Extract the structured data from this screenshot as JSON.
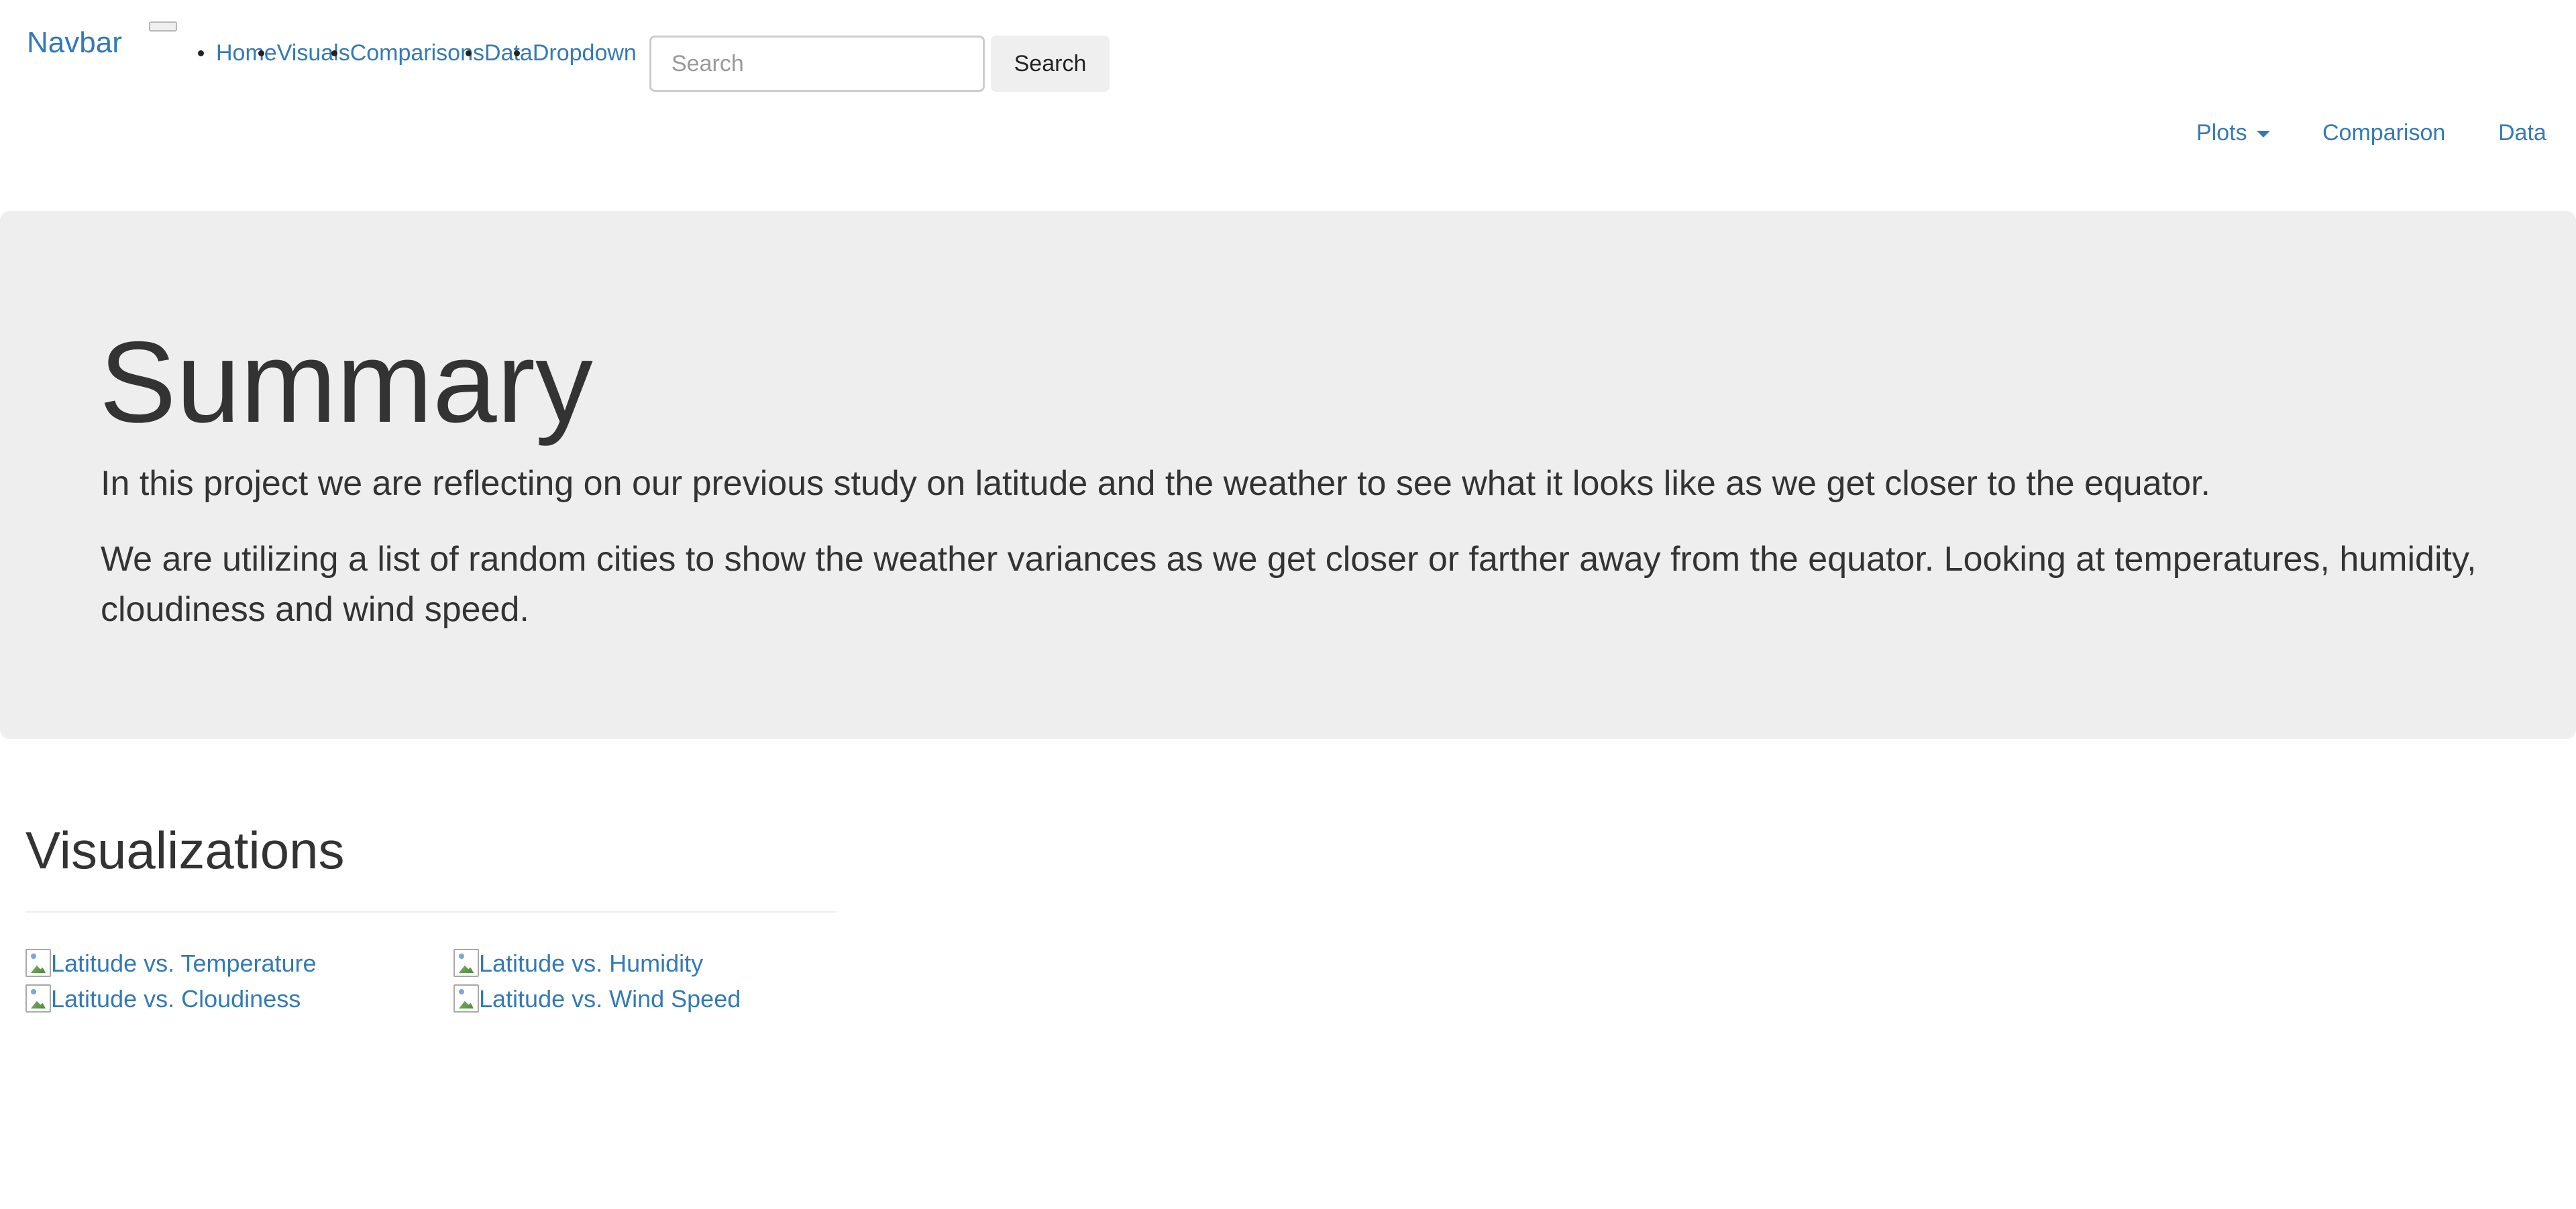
{
  "navbar": {
    "brand": "Navbar",
    "links": [
      {
        "label": "Home"
      },
      {
        "label": "Visuals"
      },
      {
        "label": "Comparisons"
      },
      {
        "label": "Data"
      },
      {
        "label": "Dropdown"
      }
    ],
    "search": {
      "placeholder": "Search",
      "value": "",
      "button_label": "Search"
    },
    "right_links": {
      "plots": "Plots",
      "comparison": "Comparison",
      "data": "Data"
    }
  },
  "jumbotron": {
    "title": "Summary",
    "paragraphs": [
      "In this project we are reflecting on our previous study on latitude and the weather to see what it looks like as we get closer to the equator.",
      "We are utilizing a list of random cities to show the weather variances as we get closer or farther away from the equator. Looking at temperatures, humidity, cloudiness and wind speed."
    ]
  },
  "visualizations": {
    "title": "Visualizations",
    "thumbnails": [
      {
        "alt": "Latitude vs. Temperature"
      },
      {
        "alt": "Latitude vs. Humidity"
      },
      {
        "alt": "Latitude vs. Cloudiness"
      },
      {
        "alt": "Latitude vs. Wind Speed"
      }
    ]
  },
  "colors": {
    "link": "#337ab7",
    "text": "#333333",
    "jumbotron_bg": "#eeeeee",
    "button_bg": "#efefef"
  }
}
